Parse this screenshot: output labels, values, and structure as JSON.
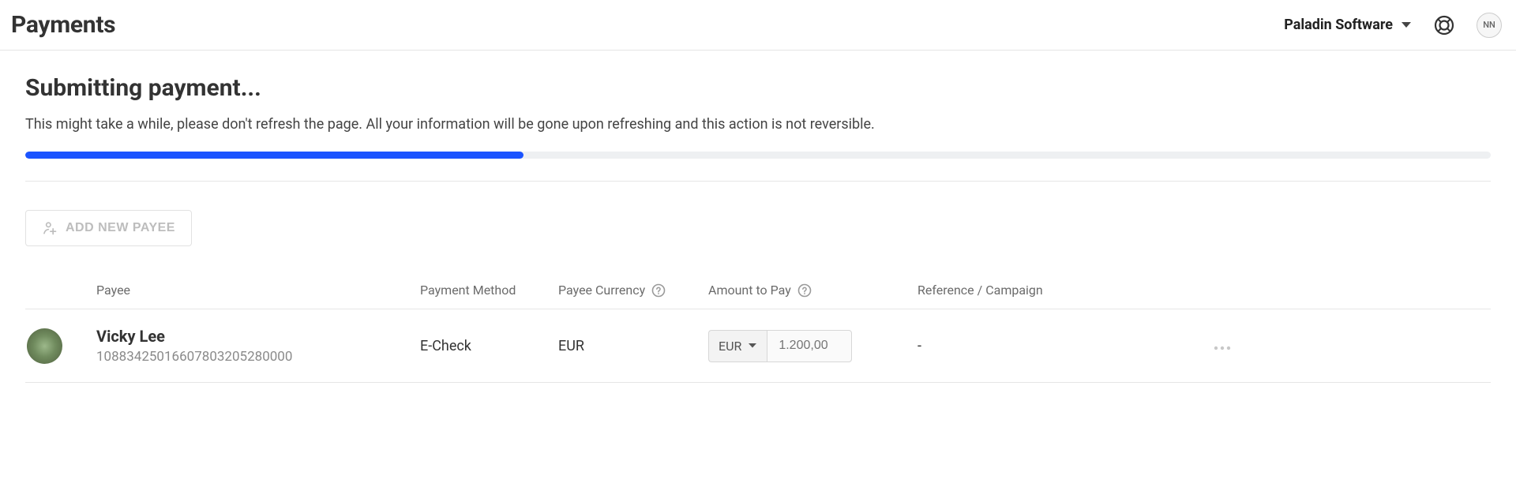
{
  "header": {
    "page_title": "Payments",
    "org_name": "Paladin Software",
    "avatar_initials": "NN"
  },
  "status": {
    "heading": "Submitting payment...",
    "message": "This might take a while, please don't refresh the page. All your information will be gone upon refreshing and this action is not reversible.",
    "progress_percent": 34
  },
  "actions": {
    "add_payee_label": "ADD NEW PAYEE"
  },
  "table": {
    "columns": {
      "payee": "Payee",
      "payment_method": "Payment Method",
      "payee_currency": "Payee Currency",
      "amount_to_pay": "Amount to Pay",
      "reference": "Reference / Campaign"
    },
    "rows": [
      {
        "name": "Vicky Lee",
        "id": "10883425016607803205280000",
        "payment_method": "E-Check",
        "payee_currency": "EUR",
        "amount_currency": "EUR",
        "amount_value": "1.200,00",
        "reference": "-"
      }
    ]
  }
}
